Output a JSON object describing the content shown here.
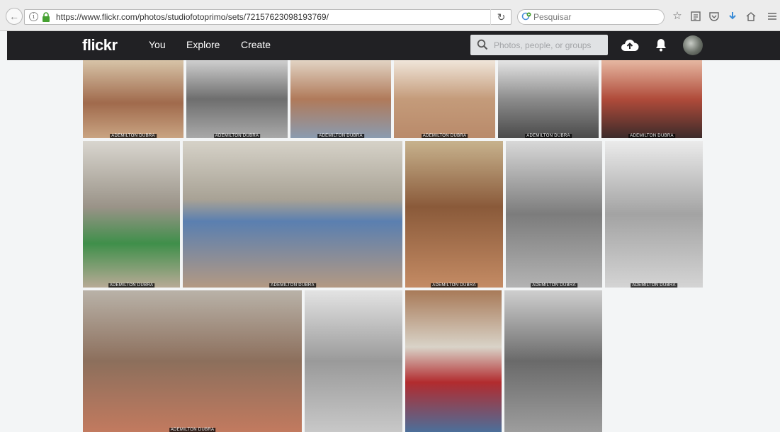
{
  "browser": {
    "url": "https://www.flickr.com/photos/studiofotoprimo/sets/72157623098193769/",
    "search_placeholder": "Pesquisar",
    "back_glyph": "←",
    "info_glyph": "i",
    "reload_glyph": "↻",
    "icons": [
      "back-icon",
      "info-icon",
      "lock-icon",
      "reload-icon",
      "search-engine-icon",
      "star-icon",
      "reading-list-icon",
      "pocket-icon",
      "download-icon",
      "home-icon",
      "menu-icon"
    ]
  },
  "flickr": {
    "logo": "flickr",
    "nav": [
      "You",
      "Explore",
      "Create"
    ],
    "search_placeholder": "Photos, people, or groups"
  },
  "watermark": "ADEMILTON DUBRA",
  "photos": [
    {
      "bg": "linear-gradient(180deg,#d7c4a8 0%,#a06a4c 55%,#c9a482 100%)"
    },
    {
      "bg": "linear-gradient(180deg,#cfcfcf 0%,#6e6e6e 50%,#a9a9a9 100%)"
    },
    {
      "bg": "linear-gradient(180deg,#e2d4c4 0%,#b07a5a 50%,#8a9bb0 100%)"
    },
    {
      "bg": "linear-gradient(180deg,#f0e6da 0%,#c49b7a 50%,#b98a6a 100%)"
    },
    {
      "bg": "linear-gradient(180deg,#e5e5e5 0%,#8c8c8c 50%,#4a4a4a 100%)"
    },
    {
      "bg": "linear-gradient(180deg,#e6b8a2 0%,#b04b3a 50%,#3c2b2a 100%)"
    },
    {
      "bg": "linear-gradient(180deg,#d9d6cf 0%,#9a9388 45%,#3f8f4a 70%,#b8aa96 100%)"
    },
    {
      "bg": "linear-gradient(180deg,#d6d2c8 0%,#a8a295 40%,#5a7fb0 55%,#b39983 100%)"
    },
    {
      "bg": "linear-gradient(180deg,#c7b28d 0%,#8a5a3a 45%,#c48b64 100%)"
    },
    {
      "bg": "linear-gradient(180deg,#d8d8d8 0%,#7c7c7c 50%,#b3b3b3 100%)"
    },
    {
      "bg": "linear-gradient(180deg,#ebebeb 0%,#a3a3a3 50%,#d4d4d4 100%)"
    },
    {
      "bg": "linear-gradient(180deg,#b9b2a8 0%,#8c6f5c 50%,#c27a5f 100%)"
    },
    {
      "bg": "linear-gradient(180deg,#e3e3e3 0%,#9a9a9a 50%,#c8c8c8 100%)"
    },
    {
      "bg": "linear-gradient(180deg,#a87a58 0%,#d9d3c8 40%,#b22b2e 65%,#4c6f9a 100%)"
    },
    {
      "bg": "linear-gradient(180deg,#cfcfcf 0%,#6a6a6a 50%,#9d9d9d 100%)"
    }
  ]
}
